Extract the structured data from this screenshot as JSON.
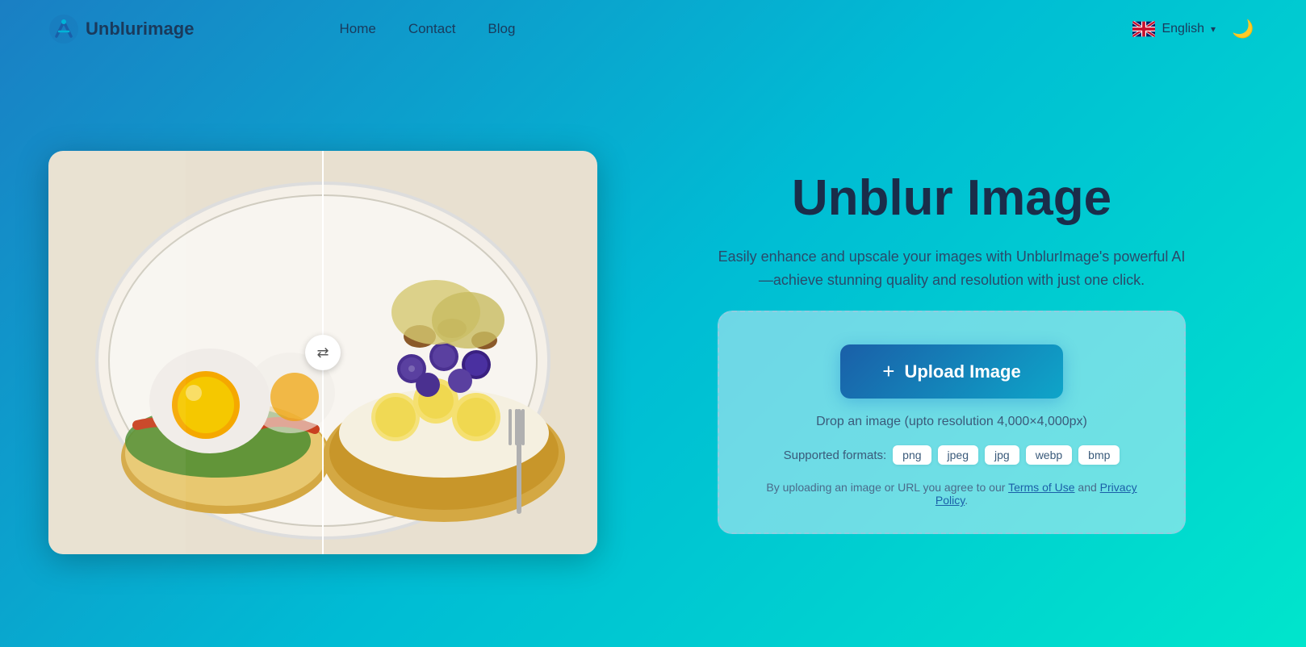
{
  "nav": {
    "logo_text": "Unblurimage",
    "links": [
      {
        "label": "Home",
        "id": "home"
      },
      {
        "label": "Contact",
        "id": "contact"
      },
      {
        "label": "Blog",
        "id": "blog"
      }
    ],
    "language": "English",
    "language_chevron": "▾",
    "theme_icon": "🌙"
  },
  "hero": {
    "title": "Unblur Image",
    "subtitle": "Easily enhance and upscale your images with UnblurImage's powerful AI—achieve stunning quality and resolution with just one click."
  },
  "upload": {
    "button_label": "Upload Image",
    "plus_icon": "+",
    "drop_text": "Drop an image (upto resolution 4,000×4,000px)",
    "formats_label": "Supported formats:",
    "formats": [
      "png",
      "jpeg",
      "jpg",
      "webp",
      "bmp"
    ],
    "terms_text": "By uploading an image or URL you agree to our Terms of Use and Privacy Policy.",
    "terms_of_use": "Terms of Use",
    "privacy_policy": "Privacy Policy"
  },
  "compare": {
    "handle_icon": "⇄"
  }
}
